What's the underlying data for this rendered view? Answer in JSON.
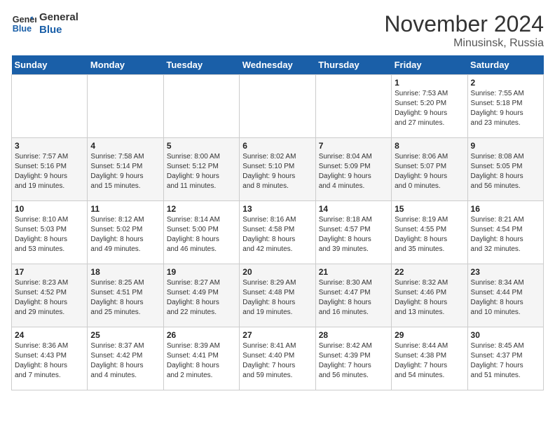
{
  "logo": {
    "line1": "General",
    "line2": "Blue"
  },
  "title": "November 2024",
  "location": "Minusinsk, Russia",
  "days_of_week": [
    "Sunday",
    "Monday",
    "Tuesday",
    "Wednesday",
    "Thursday",
    "Friday",
    "Saturday"
  ],
  "weeks": [
    [
      {
        "day": "",
        "content": ""
      },
      {
        "day": "",
        "content": ""
      },
      {
        "day": "",
        "content": ""
      },
      {
        "day": "",
        "content": ""
      },
      {
        "day": "",
        "content": ""
      },
      {
        "day": "1",
        "content": "Sunrise: 7:53 AM\nSunset: 5:20 PM\nDaylight: 9 hours\nand 27 minutes."
      },
      {
        "day": "2",
        "content": "Sunrise: 7:55 AM\nSunset: 5:18 PM\nDaylight: 9 hours\nand 23 minutes."
      }
    ],
    [
      {
        "day": "3",
        "content": "Sunrise: 7:57 AM\nSunset: 5:16 PM\nDaylight: 9 hours\nand 19 minutes."
      },
      {
        "day": "4",
        "content": "Sunrise: 7:58 AM\nSunset: 5:14 PM\nDaylight: 9 hours\nand 15 minutes."
      },
      {
        "day": "5",
        "content": "Sunrise: 8:00 AM\nSunset: 5:12 PM\nDaylight: 9 hours\nand 11 minutes."
      },
      {
        "day": "6",
        "content": "Sunrise: 8:02 AM\nSunset: 5:10 PM\nDaylight: 9 hours\nand 8 minutes."
      },
      {
        "day": "7",
        "content": "Sunrise: 8:04 AM\nSunset: 5:09 PM\nDaylight: 9 hours\nand 4 minutes."
      },
      {
        "day": "8",
        "content": "Sunrise: 8:06 AM\nSunset: 5:07 PM\nDaylight: 9 hours\nand 0 minutes."
      },
      {
        "day": "9",
        "content": "Sunrise: 8:08 AM\nSunset: 5:05 PM\nDaylight: 8 hours\nand 56 minutes."
      }
    ],
    [
      {
        "day": "10",
        "content": "Sunrise: 8:10 AM\nSunset: 5:03 PM\nDaylight: 8 hours\nand 53 minutes."
      },
      {
        "day": "11",
        "content": "Sunrise: 8:12 AM\nSunset: 5:02 PM\nDaylight: 8 hours\nand 49 minutes."
      },
      {
        "day": "12",
        "content": "Sunrise: 8:14 AM\nSunset: 5:00 PM\nDaylight: 8 hours\nand 46 minutes."
      },
      {
        "day": "13",
        "content": "Sunrise: 8:16 AM\nSunset: 4:58 PM\nDaylight: 8 hours\nand 42 minutes."
      },
      {
        "day": "14",
        "content": "Sunrise: 8:18 AM\nSunset: 4:57 PM\nDaylight: 8 hours\nand 39 minutes."
      },
      {
        "day": "15",
        "content": "Sunrise: 8:19 AM\nSunset: 4:55 PM\nDaylight: 8 hours\nand 35 minutes."
      },
      {
        "day": "16",
        "content": "Sunrise: 8:21 AM\nSunset: 4:54 PM\nDaylight: 8 hours\nand 32 minutes."
      }
    ],
    [
      {
        "day": "17",
        "content": "Sunrise: 8:23 AM\nSunset: 4:52 PM\nDaylight: 8 hours\nand 29 minutes."
      },
      {
        "day": "18",
        "content": "Sunrise: 8:25 AM\nSunset: 4:51 PM\nDaylight: 8 hours\nand 25 minutes."
      },
      {
        "day": "19",
        "content": "Sunrise: 8:27 AM\nSunset: 4:49 PM\nDaylight: 8 hours\nand 22 minutes."
      },
      {
        "day": "20",
        "content": "Sunrise: 8:29 AM\nSunset: 4:48 PM\nDaylight: 8 hours\nand 19 minutes."
      },
      {
        "day": "21",
        "content": "Sunrise: 8:30 AM\nSunset: 4:47 PM\nDaylight: 8 hours\nand 16 minutes."
      },
      {
        "day": "22",
        "content": "Sunrise: 8:32 AM\nSunset: 4:46 PM\nDaylight: 8 hours\nand 13 minutes."
      },
      {
        "day": "23",
        "content": "Sunrise: 8:34 AM\nSunset: 4:44 PM\nDaylight: 8 hours\nand 10 minutes."
      }
    ],
    [
      {
        "day": "24",
        "content": "Sunrise: 8:36 AM\nSunset: 4:43 PM\nDaylight: 8 hours\nand 7 minutes."
      },
      {
        "day": "25",
        "content": "Sunrise: 8:37 AM\nSunset: 4:42 PM\nDaylight: 8 hours\nand 4 minutes."
      },
      {
        "day": "26",
        "content": "Sunrise: 8:39 AM\nSunset: 4:41 PM\nDaylight: 8 hours\nand 2 minutes."
      },
      {
        "day": "27",
        "content": "Sunrise: 8:41 AM\nSunset: 4:40 PM\nDaylight: 7 hours\nand 59 minutes."
      },
      {
        "day": "28",
        "content": "Sunrise: 8:42 AM\nSunset: 4:39 PM\nDaylight: 7 hours\nand 56 minutes."
      },
      {
        "day": "29",
        "content": "Sunrise: 8:44 AM\nSunset: 4:38 PM\nDaylight: 7 hours\nand 54 minutes."
      },
      {
        "day": "30",
        "content": "Sunrise: 8:45 AM\nSunset: 4:37 PM\nDaylight: 7 hours\nand 51 minutes."
      }
    ]
  ]
}
